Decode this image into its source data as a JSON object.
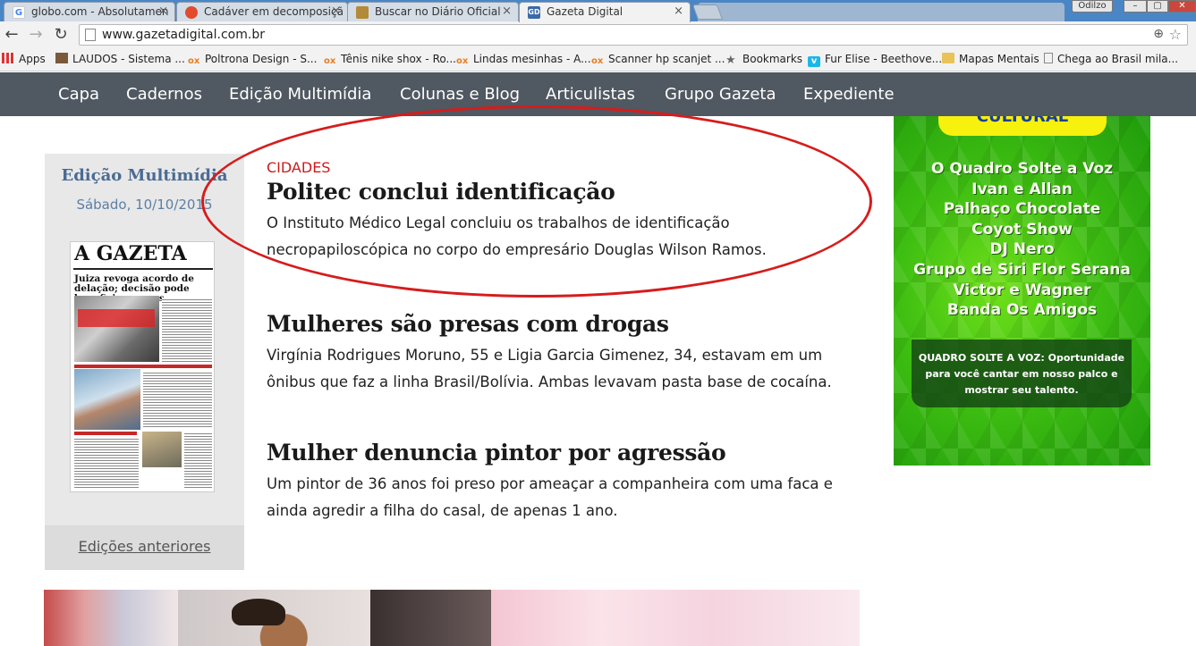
{
  "browser": {
    "tabs": [
      {
        "title": "globo.com - Absolutamen",
        "icon": "google-g-icon"
      },
      {
        "title": "Cadáver em decomposiçã",
        "icon": "chrome-icon"
      },
      {
        "title": "Buscar no Diário Oficial",
        "icon": "crest-icon"
      },
      {
        "title": "Gazeta Digital",
        "icon": "gd-icon",
        "active": true
      }
    ],
    "user_badge": "Odilzo",
    "window_buttons": [
      "–",
      "▢",
      "✕"
    ],
    "url": "www.gazetadigital.com.br",
    "bookmarks": [
      {
        "label": "Apps",
        "icon": "apps-grid-icon"
      },
      {
        "label": "LAUDOS - Sistema ...",
        "icon": "laudos-icon"
      },
      {
        "label": "Poltrona Design - S...",
        "icon": "olx-icon"
      },
      {
        "label": "Tênis nike shox - Ro...",
        "icon": "olx-icon"
      },
      {
        "label": "Lindas mesinhas - A...",
        "icon": "olx-icon"
      },
      {
        "label": "Scanner hp scanjet ...",
        "icon": "olx-icon"
      },
      {
        "label": "Bookmarks",
        "icon": "star-icon"
      },
      {
        "label": "Fur Elise - Beethove...",
        "icon": "vimeo-icon"
      },
      {
        "label": "Mapas Mentais",
        "icon": "folder-icon"
      },
      {
        "label": "Chega ao Brasil mila...",
        "icon": "page-icon"
      }
    ]
  },
  "site_nav": {
    "items": [
      "Capa",
      "Cadernos",
      "Edição Multimídia",
      "Colunas e Blog",
      "Articulistas",
      "Grupo Gazeta",
      "Expediente"
    ]
  },
  "sidebar": {
    "title": "Edição Multimídia",
    "date": "Sábado, 10/10/2015",
    "newspaper": {
      "masthead": "A GAZETA",
      "headline": "Juiza revoga acordo de delação; decisão pode beneficiar presos"
    },
    "footer_link": "Edições anteriores"
  },
  "articles": [
    {
      "kicker": "CIDADES",
      "headline": "Politec conclui identificação",
      "summary": "O Instituto Médico Legal concluiu os trabalhos de identificação necropapiloscópica no corpo do empresário Douglas Wilson Ramos."
    },
    {
      "kicker": "",
      "headline": "Mulheres são presas com drogas",
      "summary": "Virgínia Rodrigues Moruno, 55 e Ligia Garcia Gimenez, 34, estavam em um ônibus que faz a linha Brasil/Bolívia. Ambas levavam pasta base de cocaína."
    },
    {
      "kicker": "",
      "headline": "Mulher denuncia pintor por agressão",
      "summary": "Um pintor de 36 anos foi preso por ameaçar a companheira com uma faca e ainda agredir a filha do casal, de apenas 1 ano."
    }
  ],
  "ad": {
    "banner": "CULTURAL",
    "lineup": [
      "O Quadro Solte a Voz",
      "Ivan e Allan",
      "Palhaço Chocolate",
      "Coyot Show",
      "DJ Nero",
      "Grupo de Siri Flor Serana",
      "Victor e Wagner",
      "Banda Os Amigos"
    ],
    "note": "QUADRO SOLTE A VOZ: Oportunidade para você cantar em nosso palco e mostrar seu talento."
  },
  "colors": {
    "nav_bg": "#505861",
    "kicker": "#cc1b1b",
    "annotation_circle": "#d61c1c",
    "sidebar_title": "#4a6b93",
    "ad_green": "#3fbf12"
  }
}
